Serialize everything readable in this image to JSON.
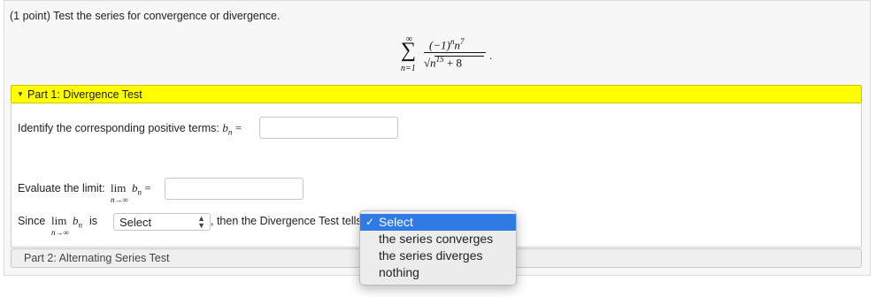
{
  "problem": {
    "title": "(1 point) Test the series for convergence or divergence."
  },
  "equation": {
    "sum_upper": "∞",
    "sum_symbol": "∑",
    "sum_lower": "n=1",
    "numerator_base": "(−1)",
    "numerator_exp1": "n",
    "numerator_var": "n",
    "numerator_exp2": "7",
    "denominator_root": "√",
    "denominator_var": "n",
    "denominator_exp": "15",
    "denominator_rest": " + 8",
    "trailing": "."
  },
  "part1": {
    "header_label": "Part 1: Divergence Test",
    "identify_label": "Identify the corresponding positive terms:",
    "b_var": "b",
    "b_sub": "n",
    "equals": "=",
    "evaluate_label": "Evaluate the limit:",
    "lim_word": "lim",
    "lim_sub": "n→∞",
    "since_label": "Since",
    "is_label": "is",
    "select_value": "Select",
    "then_label": ", then the Divergence Test tells u"
  },
  "dropdown": {
    "check": "✓",
    "options": [
      "Select",
      "the series converges",
      "the series diverges",
      "nothing"
    ],
    "selected_index": 0
  },
  "part2": {
    "header_label": "Part 2: Alternating Series Test"
  },
  "colors": {
    "part1_header_bg": "#ffff00",
    "dropdown_selected_bg": "#2f7ae5"
  }
}
